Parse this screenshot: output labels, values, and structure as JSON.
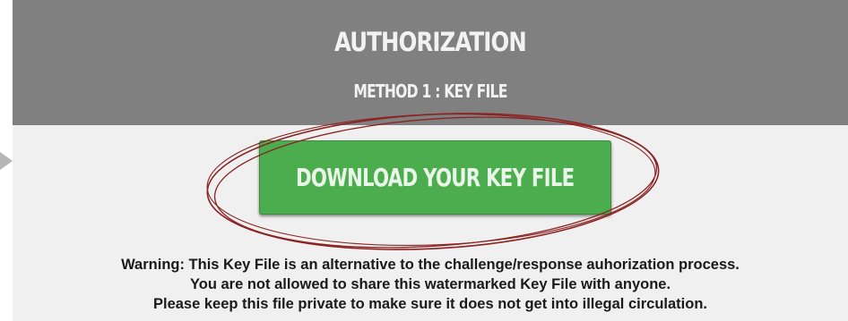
{
  "header": {
    "title": "AUTHORIZATION",
    "subtitle": "METHOD 1 : KEY FILE"
  },
  "download_button": {
    "label": "DOWNLOAD YOUR KEY FILE"
  },
  "warning": {
    "lines": [
      "Warning: This Key File is an alternative to the challenge/response auhorization process.",
      "You are not allowed to share this watermarked Key File with anyone.",
      "Please keep this file private to make sure it does not get into illegal circulation."
    ]
  },
  "colors": {
    "header_bg": "#808080",
    "panel_bg": "#f0f0f0",
    "button_green": "#4cad4e",
    "annotation_red": "#8b2323"
  },
  "icons": {
    "pointer": "pointer-arrow-icon",
    "annotation": "highlight-ellipse"
  }
}
